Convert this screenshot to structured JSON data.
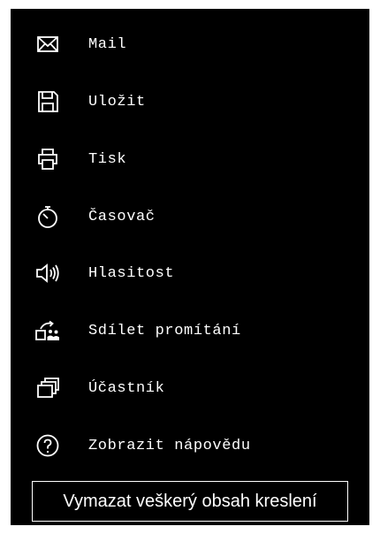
{
  "menu": {
    "items": [
      {
        "label": "Mail",
        "icon": "mail-icon"
      },
      {
        "label": "Uložit",
        "icon": "save-icon"
      },
      {
        "label": "Tisk",
        "icon": "print-icon"
      },
      {
        "label": "Časovač",
        "icon": "timer-icon"
      },
      {
        "label": "Hlasitost",
        "icon": "volume-icon"
      },
      {
        "label": "Sdílet promítání",
        "icon": "share-screen-icon"
      },
      {
        "label": "Účastník",
        "icon": "participants-icon"
      },
      {
        "label": "Zobrazit nápovědu",
        "icon": "help-icon"
      }
    ]
  },
  "clear_button": {
    "label": "Vymazat veškerý obsah kreslení"
  },
  "colors": {
    "background": "#000000",
    "foreground": "#ffffff"
  }
}
